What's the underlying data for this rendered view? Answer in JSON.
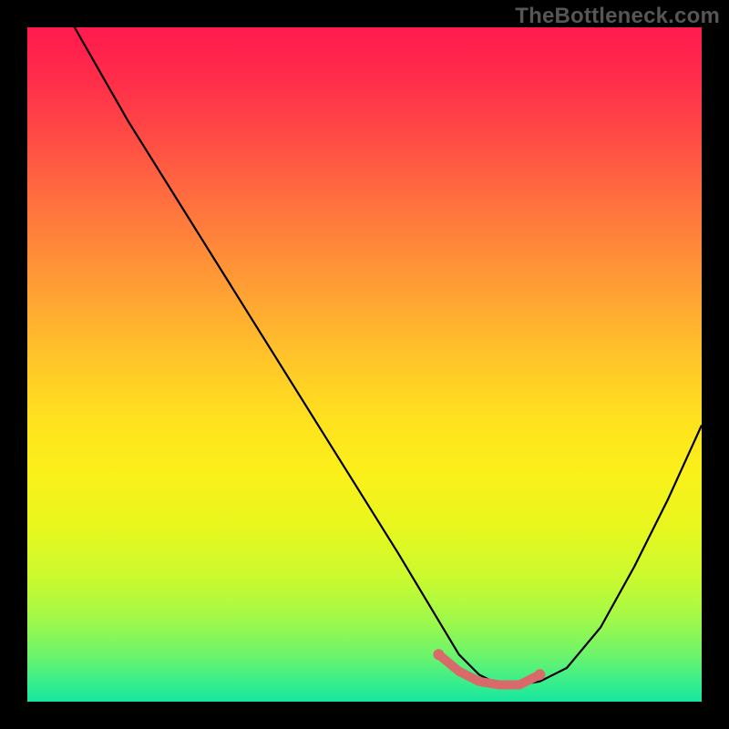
{
  "watermark": "TheBottleneck.com",
  "chart_data": {
    "type": "line",
    "title": "",
    "xlabel": "",
    "ylabel": "",
    "xlim": [
      0,
      100
    ],
    "ylim": [
      0,
      100
    ],
    "curve": {
      "name": "bottleneck-curve",
      "x": [
        7,
        15,
        25,
        35,
        45,
        55,
        61,
        64,
        67,
        70,
        73,
        76,
        80,
        85,
        90,
        95,
        100
      ],
      "y": [
        100,
        86,
        70,
        54,
        38,
        22,
        12,
        7,
        4,
        2.5,
        2.5,
        3,
        5,
        11,
        20,
        30,
        41
      ]
    },
    "highlight_segment": {
      "name": "optimal-range",
      "color": "#d96a6a",
      "x": [
        61,
        64,
        67,
        70,
        73,
        76
      ],
      "y": [
        7,
        4.5,
        3,
        2.5,
        2.5,
        4
      ]
    },
    "background_gradient": {
      "top": "#ff1a4e",
      "mid": "#ffe11f",
      "bottom": "#17e69f"
    }
  }
}
